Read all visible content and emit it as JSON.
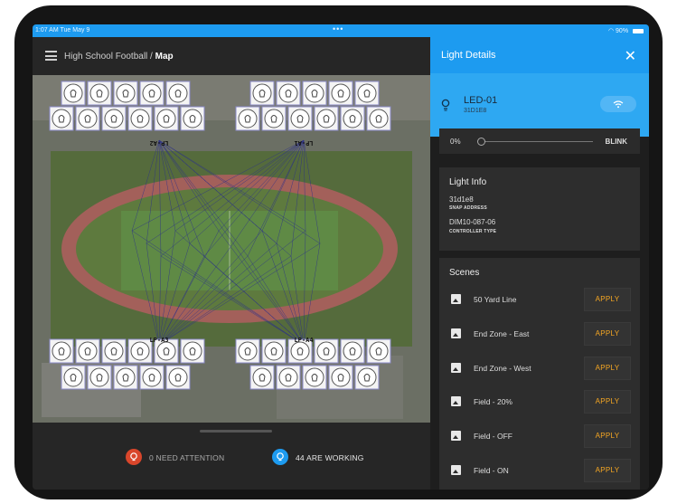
{
  "status_bar": {
    "time_date": "1:07 AM  Tue May 9",
    "dots": "•••",
    "battery": "90%"
  },
  "header": {
    "menu_icon": "hamburger-menu-icon",
    "breadcrumb_parent": "High School Football",
    "separator": " / ",
    "breadcrumb_current": "Map"
  },
  "map": {
    "poles": [
      {
        "label": "LP-A2"
      },
      {
        "label": "LP-A1"
      },
      {
        "label": "LP-A3"
      },
      {
        "label": "LP-A4"
      }
    ]
  },
  "footer": {
    "attention": {
      "text": "0 NEED ATTENTION",
      "color": "#d9462b"
    },
    "working": {
      "text": "44 ARE WORKING",
      "color": "#1d9bf0"
    }
  },
  "panel": {
    "title": "Light Details",
    "close_icon": "close-icon",
    "light": {
      "name": "LED-01",
      "id": "31D1E8",
      "bulb_icon": "lightbulb-icon",
      "signal_icon": "wifi-icon"
    },
    "slider": {
      "value_text": "0%",
      "level": 0,
      "blink_label": "BLINK"
    },
    "info": {
      "title": "Light Info",
      "snap_address": "31d1e8",
      "snap_address_label": "SNAP ADDRESS",
      "controller_type": "DIM10-087-06",
      "controller_type_label": "CONTROLLER TYPE"
    },
    "scenes": {
      "title": "Scenes",
      "apply_label": "APPLY",
      "items": [
        {
          "label": "50 Yard Line"
        },
        {
          "label": "End Zone - East"
        },
        {
          "label": "End Zone - West"
        },
        {
          "label": "Field - 20%"
        },
        {
          "label": "Field - OFF"
        },
        {
          "label": "Field - ON"
        }
      ]
    }
  },
  "colors": {
    "accent": "#1d9bf0",
    "apply": "#f5a623",
    "attention": "#d9462b"
  }
}
